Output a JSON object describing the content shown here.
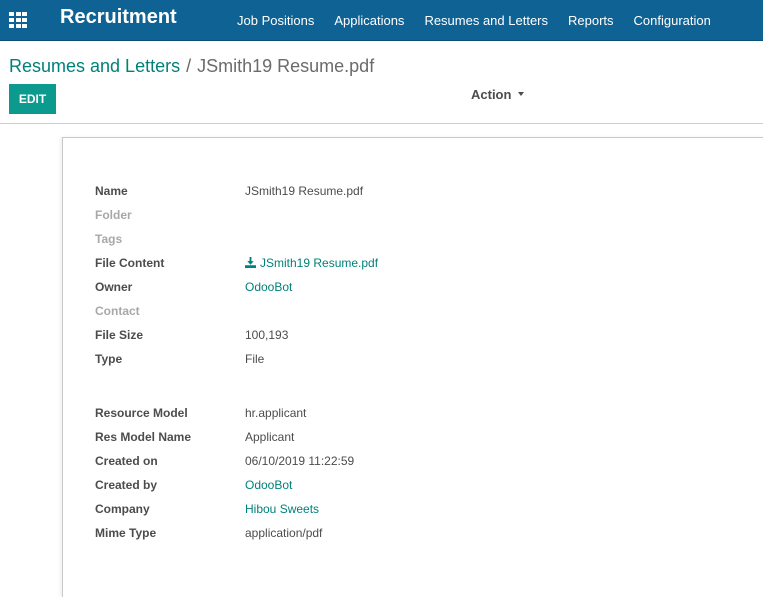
{
  "navbar": {
    "app_title": "Recruitment",
    "menu": [
      "Job Positions",
      "Applications",
      "Resumes and Letters",
      "Reports",
      "Configuration"
    ],
    "apps_icon": "apps-grid-icon",
    "color": "#0e6294"
  },
  "control_panel": {
    "breadcrumb_parent": "Resumes and Letters",
    "breadcrumb_separator": "/",
    "breadcrumb_current": "JSmith19 Resume.pdf",
    "edit_label": "EDIT",
    "action_label": "Action",
    "accent": "#0b9a8d"
  },
  "form": {
    "group1": [
      {
        "label": "Name",
        "value": "JSmith19 Resume.pdf",
        "muted": false,
        "link": false
      },
      {
        "label": "Folder",
        "value": "",
        "muted": true,
        "link": false
      },
      {
        "label": "Tags",
        "value": "",
        "muted": true,
        "link": false
      },
      {
        "label": "File Content",
        "value": "JSmith19 Resume.pdf",
        "muted": false,
        "link": true,
        "icon": "download-icon"
      },
      {
        "label": "Owner",
        "value": "OdooBot",
        "muted": false,
        "link": true
      },
      {
        "label": "Contact",
        "value": "",
        "muted": true,
        "link": false
      },
      {
        "label": "File Size",
        "value": "100,193",
        "muted": false,
        "link": false
      },
      {
        "label": "Type",
        "value": "File",
        "muted": false,
        "link": false
      }
    ],
    "group2": [
      {
        "label": "Resource Model",
        "value": "hr.applicant",
        "muted": false,
        "link": false
      },
      {
        "label": "Res Model Name",
        "value": "Applicant",
        "muted": false,
        "link": false
      },
      {
        "label": "Created on",
        "value": "06/10/2019 11:22:59",
        "muted": false,
        "link": false
      },
      {
        "label": "Created by",
        "value": "OdooBot",
        "muted": false,
        "link": true
      },
      {
        "label": "Company",
        "value": "Hibou Sweets",
        "muted": false,
        "link": true
      },
      {
        "label": "Mime Type",
        "value": "application/pdf",
        "muted": false,
        "link": false
      }
    ]
  }
}
